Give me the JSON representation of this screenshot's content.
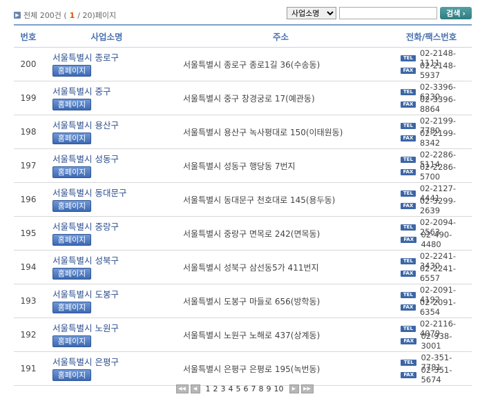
{
  "summary": {
    "prefix": "전체 200건 (",
    "current": "1",
    "suffix": " / 20)페이지"
  },
  "search": {
    "select_value": "사업소명",
    "button_label": "검색"
  },
  "columns": {
    "no": "번호",
    "name": "사업소명",
    "address": "주소",
    "phone": "전화/팩스번호"
  },
  "labels": {
    "homepage": "홈페이지",
    "tel": "TEL",
    "fax": "FAX"
  },
  "rows": [
    {
      "no": "200",
      "name": "서울특별시 종로구",
      "address": "서울특별시 종로구 종로1길 36(수송동)",
      "tel": "02-2148-1111",
      "fax": "02-2148-5937"
    },
    {
      "no": "199",
      "name": "서울특별시 중구",
      "address": "서울특별시 중구 창경궁로 17(예관동)",
      "tel": "02-3396-6230",
      "fax": "02-3396-8864"
    },
    {
      "no": "198",
      "name": "서울특별시 용산구",
      "address": "서울특별시 용산구 녹사평대로 150(이태원동)",
      "tel": "02-2199-7780",
      "fax": "02-2199-8342"
    },
    {
      "no": "197",
      "name": "서울특별시 성동구",
      "address": "서울특별시 성동구 행당동 7번지",
      "tel": "02-2286-5114",
      "fax": "02-2286-5700"
    },
    {
      "no": "196",
      "name": "서울특별시 동대문구",
      "address": "서울특별시 동대문구 천호대로 145(용두동)",
      "tel": "02-2127-4441",
      "fax": "02-3299-2639"
    },
    {
      "no": "195",
      "name": "서울특별시 중랑구",
      "address": "서울특별시 중랑구 면목로 242(면목동)",
      "tel": "02-2094-2563",
      "fax": "02-490-4480"
    },
    {
      "no": "194",
      "name": "서울특별시 성북구",
      "address": "서울특별시 성북구 삼선동5가 411번지",
      "tel": "02-2241-3430",
      "fax": "02-2241-6557"
    },
    {
      "no": "193",
      "name": "서울특별시 도봉구",
      "address": "서울특별시 도봉구 마들로 656(방학동)",
      "tel": "02-2091-4192",
      "fax": "02-2091-6354"
    },
    {
      "no": "192",
      "name": "서울특별시 노원구",
      "address": "서울특별시 노원구 노해로 437(상계동)",
      "tel": "02-2116-4079",
      "fax": "02-938-3001"
    },
    {
      "no": "191",
      "name": "서울특별시 은평구",
      "address": "서울특별시 은평구 은평로 195(녹번동)",
      "tel": "02-351-7781",
      "fax": "02-351-5674"
    }
  ],
  "pagination": {
    "pages": [
      "1",
      "2",
      "3",
      "4",
      "5",
      "6",
      "7",
      "8",
      "9",
      "10"
    ]
  },
  "colors": {
    "accent": "#4b72b1",
    "current_page": "#e05000",
    "search_button": "#2f7c80"
  }
}
